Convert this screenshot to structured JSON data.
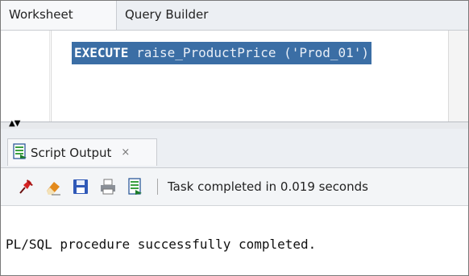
{
  "tabs": {
    "worksheet": "Worksheet",
    "query_builder": "Query Builder"
  },
  "editor": {
    "keyword": "EXECUTE",
    "code_rest": " raise_ProductPrice ('Prod_01')"
  },
  "output_panel": {
    "tab_label": "Script Output",
    "close_symbol": "×",
    "status": "Task completed in 0.019 seconds",
    "result": "PL/SQL procedure successfully completed."
  },
  "icons": {
    "toolbar": [
      "pin-icon",
      "eraser-icon",
      "save-icon",
      "print-icon",
      "script-icon"
    ]
  },
  "colors": {
    "selection": "#3b6ea5",
    "pin": "#d62222",
    "eraser": "#e38a1c",
    "save": "#2f59b8"
  }
}
